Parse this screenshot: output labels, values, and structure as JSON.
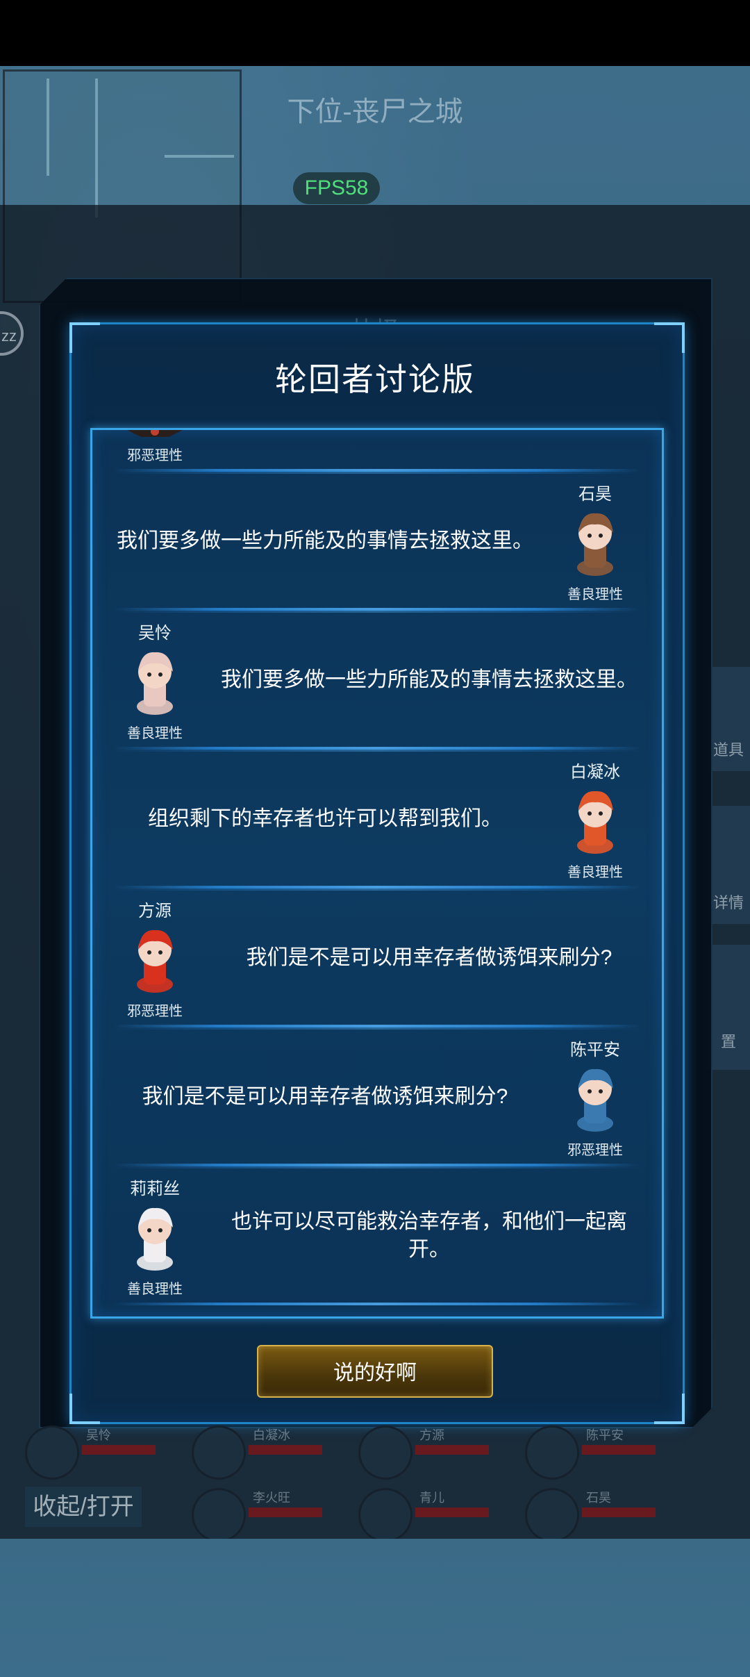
{
  "map": {
    "title": "下位-丧尸之城",
    "fps": "FPS58"
  },
  "hud": {
    "side_badge": "zz",
    "right_tabs": [
      "道具",
      "详情",
      "置"
    ],
    "outer_panel_title": "抉择",
    "collapse_label": "收起/打开",
    "team": [
      {
        "name": "吴怜"
      },
      {
        "name": "白凝冰"
      },
      {
        "name": "方源"
      },
      {
        "name": "陈平安"
      },
      {
        "name": "李火旺"
      },
      {
        "name": "青儿"
      },
      {
        "name": "石昊"
      }
    ]
  },
  "dialog": {
    "title": "轮回者讨论版",
    "confirm_label": "说的好啊",
    "partial_top": {
      "trait": "邪恶理性"
    },
    "messages": [
      {
        "side": "right",
        "name": "石昊",
        "trait": "善良理性",
        "text": "我们要多做一些力所能及的事情去拯救这里。",
        "avatar": "warrior-avatar",
        "color": "#8a5a3a"
      },
      {
        "side": "left",
        "name": "吴怜",
        "trait": "善良理性",
        "text": "我们要多做一些力所能及的事情去拯救这里。",
        "avatar": "sheep-girl-avatar",
        "color": "#e8c8c0"
      },
      {
        "side": "right",
        "name": "白凝冰",
        "trait": "善良理性",
        "text": "组织剩下的幸存者也许可以帮到我们。",
        "avatar": "fire-girl-avatar",
        "color": "#e2572a"
      },
      {
        "side": "left",
        "name": "方源",
        "trait": "邪恶理性",
        "text": "我们是不是可以用幸存者做诱饵来刷分?",
        "avatar": "flame-hair-avatar",
        "color": "#d8321e"
      },
      {
        "side": "right",
        "name": "陈平安",
        "trait": "邪恶理性",
        "text": "我们是不是可以用幸存者做诱饵来刷分?",
        "avatar": "dragon-boy-avatar",
        "color": "#3a7ab0"
      },
      {
        "side": "left",
        "name": "莉莉丝",
        "trait": "善良理性",
        "text": "也许可以尽可能救治幸存者，和他们一起离开。",
        "avatar": "fox-girl-avatar",
        "color": "#f0eef0"
      }
    ]
  },
  "colors": {
    "frame": "#3aa6e8",
    "fps_text": "#4fe07a",
    "button_border": "#d9b24a"
  }
}
